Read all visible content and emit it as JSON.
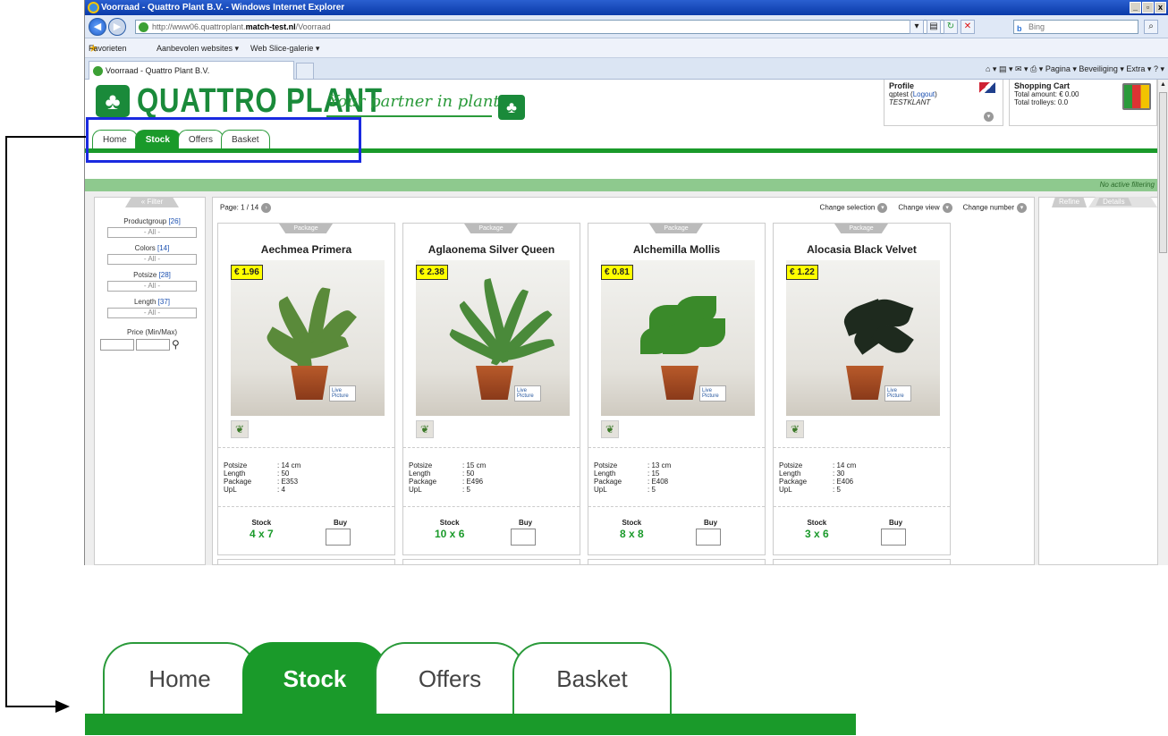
{
  "browser": {
    "window_title": "Voorraad - Quattro Plant B.V. - Windows Internet Explorer",
    "url_prefix": "http://www06.quattroplant.",
    "url_bold": "match-test.nl",
    "url_suffix": "/Voorraad",
    "search_placeholder": "Bing",
    "favorites_label": "Favorieten",
    "fav_items": [
      "Aanbevolen websites ▾",
      "Web Slice-galerie ▾"
    ],
    "tab_title": "Voorraad - Quattro Plant B.V.",
    "commands": "Pagina ▾   Beveiliging ▾   Extra ▾"
  },
  "site": {
    "logo_text_1": "QUATTRO",
    "logo_text_2": "PLANT",
    "slogan": "Your partner in plants",
    "profile": {
      "title": "Profile",
      "user": "qptest",
      "logout": "Logout",
      "customer": "TESTKLANT"
    },
    "cart": {
      "title": "Shopping Cart",
      "amount": "Total amount: € 0.00",
      "trolleys": "Total trolleys: 0.0"
    },
    "tabs": [
      "Home",
      "Stock",
      "Offers",
      "Basket"
    ],
    "active_tab": "Stock",
    "filter_status": "No active filtering"
  },
  "filter": {
    "head": "Filter",
    "collapse": "«",
    "groups": [
      {
        "label": "Productgroup",
        "count": "[26]",
        "value": "- All -"
      },
      {
        "label": "Colors",
        "count": "[14]",
        "value": "- All -"
      },
      {
        "label": "Potsize",
        "count": "[28]",
        "value": "- All -"
      },
      {
        "label": "Length",
        "count": "[37]",
        "value": "- All -"
      }
    ],
    "price_label": "Price (Min/Max)"
  },
  "listing": {
    "page": "Page: 1 / 14",
    "change_selection": "Change selection",
    "change_view": "Change view",
    "change_number": "Change number",
    "package_tag": "Package",
    "stock_label": "Stock",
    "buy_label": "Buy",
    "spec_labels": [
      "Potsize",
      "Length",
      "Package",
      "UpL"
    ],
    "products": [
      {
        "name": "Aechmea Primera",
        "price": "€ 1.96",
        "potsize": ": 14 cm",
        "length": ": 50",
        "package": ": E353",
        "upl": ": 4",
        "stock": "4 x 7"
      },
      {
        "name": "Aglaonema Silver Queen",
        "price": "€ 2.38",
        "potsize": ": 15 cm",
        "length": ": 50",
        "package": ": E496",
        "upl": ": 5",
        "stock": "10 x 6"
      },
      {
        "name": "Alchemilla Mollis",
        "price": "€ 0.81",
        "potsize": ": 13 cm",
        "length": ": 15",
        "package": ": E408",
        "upl": ": 5",
        "stock": "8 x 8"
      },
      {
        "name": "Alocasia Black Velvet",
        "price": "€ 1.22",
        "potsize": ": 14 cm",
        "length": ": 30",
        "package": ": E406",
        "upl": ": 5",
        "stock": "3 x 6"
      }
    ]
  },
  "right_panel": {
    "tab1": "Refine",
    "tab2": "Details",
    "expand": "»"
  },
  "live_label": "Live Picture",
  "colors": {
    "brand_green": "#1a9a2a",
    "highlight_blue": "#1a2ae0",
    "price_yellow": "#ffff00"
  }
}
